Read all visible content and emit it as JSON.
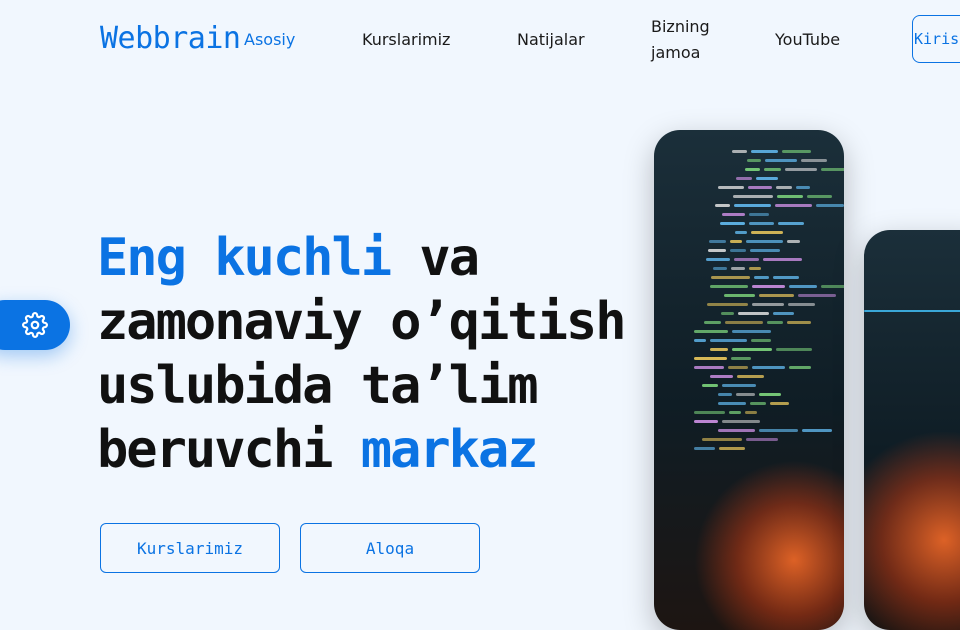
{
  "header": {
    "logo": "Webbrain",
    "nav": [
      {
        "label": "Asosiy",
        "active": true
      },
      {
        "label": "Kurslarimiz",
        "active": false
      },
      {
        "label": "Natijalar",
        "active": false
      },
      {
        "label": "Bizning jamoa",
        "active": false
      },
      {
        "label": "YouTube",
        "active": false
      }
    ],
    "login_label": "Kirish"
  },
  "hero": {
    "headline": {
      "part1": "Eng kuchli",
      "part2": " va zamonaviy o’qitish uslubida ta’lim beruvchi ",
      "part3": "markaz"
    },
    "buttons": {
      "courses": "Kurslarimiz",
      "contact": "Aloqa"
    }
  },
  "settings_fab": {
    "icon": "gear-icon"
  },
  "colors": {
    "accent": "#0b73e3",
    "background": "#f1f7fe",
    "text": "#111111"
  }
}
